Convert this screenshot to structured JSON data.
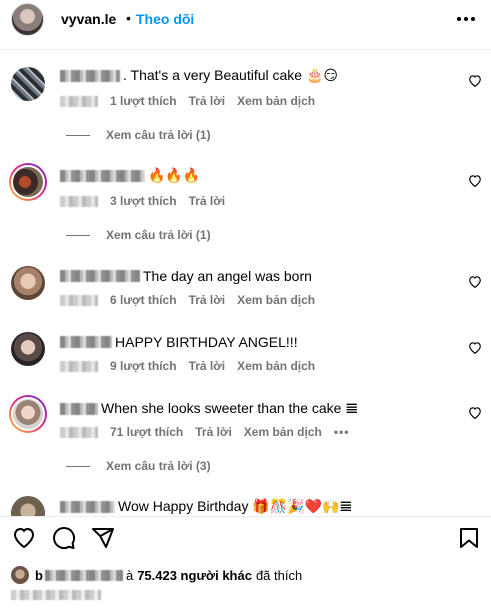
{
  "header": {
    "username": "vyvan.le",
    "separator": "•",
    "follow_label": "Theo dõi"
  },
  "comments": [
    {
      "text": ". That's a very Beautiful cake 🎂😏",
      "likes": "1 lượt thích",
      "reply": "Trả lời",
      "translate": "Xem bản dịch",
      "view_replies": "Xem câu trả lời (1)"
    },
    {
      "text": "🔥🔥🔥",
      "likes": "3 lượt thích",
      "reply": "Trả lời",
      "view_replies": "Xem câu trả lời (1)"
    },
    {
      "text": "The day an angel was born",
      "likes": "6 lượt thích",
      "reply": "Trả lời",
      "translate": "Xem bản dịch"
    },
    {
      "text": "HAPPY BIRTHDAY ANGEL!!!",
      "likes": "9 lượt thích",
      "reply": "Trả lời",
      "translate": "Xem bản dịch"
    },
    {
      "text": "When she looks sweeter than the cake 𝌆",
      "likes": "71 lượt thích",
      "reply": "Trả lời",
      "translate": "Xem bản dịch",
      "more": "•••",
      "view_replies": "Xem câu trả lời (3)"
    },
    {
      "text": "Wow Happy Birthday 🎁🎊🎉❤️🙌𝌆"
    }
  ],
  "actions": {
    "icons": [
      "heart-icon",
      "comment-icon",
      "share-icon",
      "bookmark-icon"
    ]
  },
  "likes_summary": {
    "prefix": "à",
    "count": "75.423 người khác",
    "suffix": "đã thích"
  },
  "colors": {
    "accent": "#0095f6",
    "secondary_text": "#737373"
  }
}
